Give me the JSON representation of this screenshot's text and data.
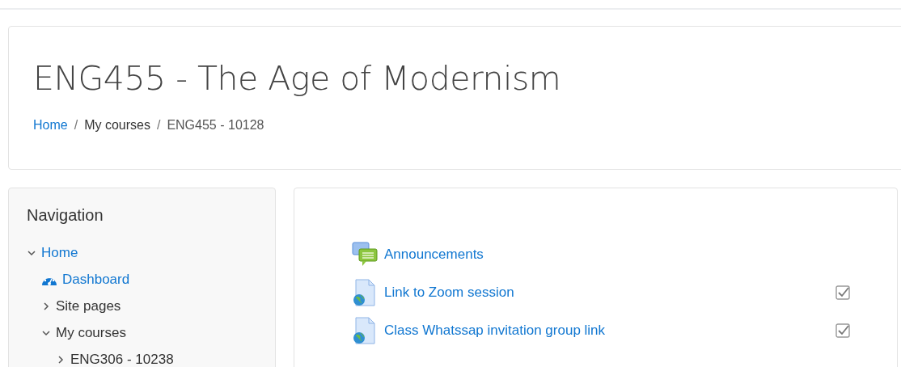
{
  "header": {
    "title": "ENG455 - The Age of Modernism",
    "breadcrumb_separator": "/",
    "breadcrumb": [
      {
        "label": "Home",
        "link": true
      },
      {
        "label": "My courses",
        "link": false,
        "kind": "category"
      },
      {
        "label": "ENG455 - 10128",
        "link": false,
        "kind": "current"
      }
    ]
  },
  "navigation": {
    "title": "Navigation",
    "items": [
      {
        "label": "Home",
        "kind": "branch",
        "link": true,
        "expanded": true,
        "children": [
          {
            "label": "Dashboard",
            "kind": "dashboard",
            "link": true
          },
          {
            "label": "Site pages",
            "kind": "branch",
            "link": false,
            "expanded": false
          },
          {
            "label": "My courses",
            "kind": "branch",
            "link": false,
            "expanded": true,
            "children": [
              {
                "label": "ENG306 - 10238",
                "kind": "branch",
                "link": false,
                "expanded": false
              }
            ]
          }
        ]
      }
    ]
  },
  "activities": [
    {
      "label": "Announcements",
      "kind": "forum"
    },
    {
      "label": "Link to Zoom session",
      "kind": "url",
      "completion": {
        "checked": true
      }
    },
    {
      "label": "Class Whatssap invitation group link",
      "kind": "url",
      "completion": {
        "checked": true
      }
    }
  ]
}
